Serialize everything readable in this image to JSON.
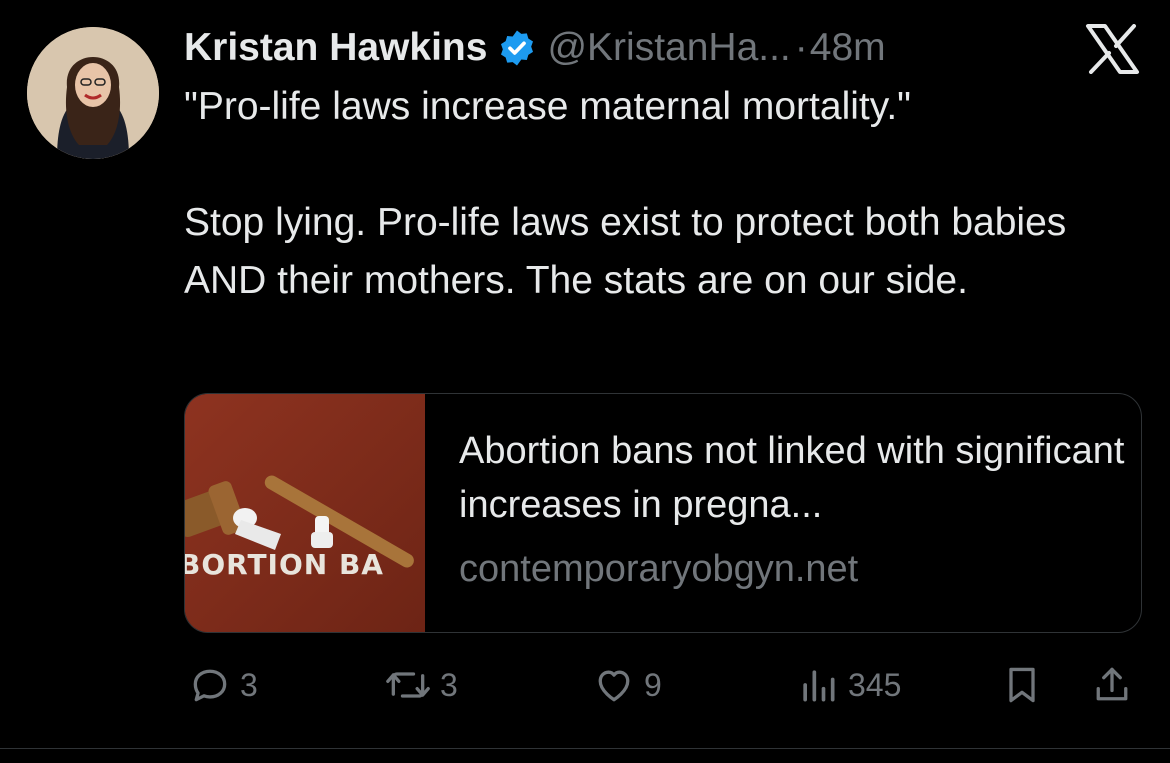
{
  "tweet": {
    "author_name": "Kristan Hawkins",
    "handle": "@KristanHa...",
    "separator": "·",
    "time": "48m",
    "verified_icon": "verified-badge-icon",
    "text_lines": [
      "\"Pro-life laws increase maternal mortality.\"",
      "Stop lying. Pro-life laws exist to protect both babies AND their mothers. The stats are on our side."
    ]
  },
  "link_card": {
    "title": "Abortion bans not linked with significant increases in pregna...",
    "domain": "contemporaryobgyn.net",
    "thumbnail_text": "BORTION BA"
  },
  "actions": {
    "replies": {
      "icon": "reply-icon",
      "count": "3"
    },
    "reposts": {
      "icon": "repost-icon",
      "count": "3"
    },
    "likes": {
      "icon": "like-icon",
      "count": "9"
    },
    "views": {
      "icon": "views-icon",
      "count": "345"
    },
    "bookmark": {
      "icon": "bookmark-icon"
    },
    "share": {
      "icon": "share-icon"
    }
  },
  "colors": {
    "background": "#000000",
    "text": "#e7e9ea",
    "secondary_text": "#71767b",
    "verified_blue": "#1d9bf0",
    "border": "#2f3336"
  }
}
